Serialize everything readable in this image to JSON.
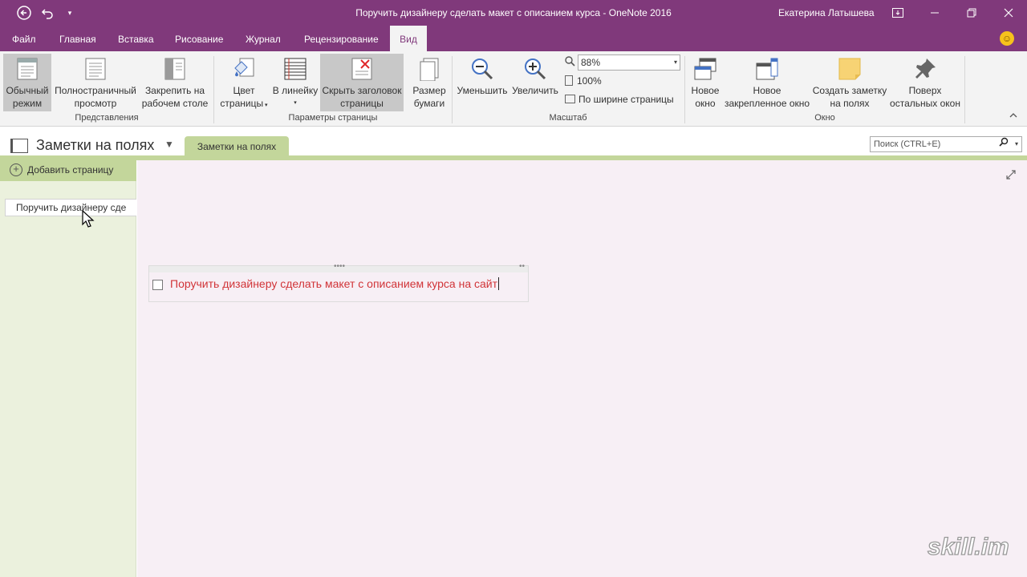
{
  "titlebar": {
    "title": "Поручить дизайнеру сделать макет с описанием курса  -  OneNote 2016",
    "user": "Екатерина Латышева",
    "back_icon": "back-arrow-icon",
    "undo_icon": "undo-icon",
    "customize_icon": "customize-dropdown-icon",
    "colors": {
      "bar": "#80397b"
    }
  },
  "menu": {
    "file": "Файл",
    "home": "Главная",
    "insert": "Вставка",
    "draw": "Рисование",
    "history": "Журнал",
    "review": "Рецензирование",
    "view": "Вид"
  },
  "ribbon": {
    "views": {
      "normal_1": "Обычный",
      "normal_2": "режим",
      "fullpage_1": "Полностраничный",
      "fullpage_2": "просмотр",
      "dock_1": "Закрепить на",
      "dock_2": "рабочем столе",
      "group": "Представления"
    },
    "page_setup": {
      "color_1": "Цвет",
      "color_2": "страницы",
      "ruled": "В линейку",
      "hide_title_1": "Скрыть заголовок",
      "hide_title_2": "страницы",
      "paper_1": "Размер",
      "paper_2": "бумаги",
      "group": "Параметры страницы"
    },
    "zoom": {
      "zoom_out": "Уменьшить",
      "zoom_in": "Увеличить",
      "value": "88%",
      "hundred": "100%",
      "page_width": "По ширине страницы",
      "group": "Масштаб"
    },
    "window": {
      "new_1": "Новое",
      "new_2": "окно",
      "docked_1": "Новое",
      "docked_2": "закрепленное окно",
      "quick_1": "Создать заметку",
      "quick_2": "на полях",
      "ontop_1": "Поверх",
      "ontop_2": "остальных окон",
      "group": "Окно"
    }
  },
  "notebook": {
    "name": "Заметки на полях",
    "section": "Заметки на полях",
    "search_placeholder": "Поиск (CTRL+E)",
    "colors": {
      "section": "#c3d69b",
      "pagelist": "#ebf1dd",
      "canvas": "#f7eff5"
    }
  },
  "pages": {
    "add_page": "Добавить страницу",
    "items": [
      "Поручить дизайнеру сде"
    ]
  },
  "note": {
    "text": "Поручить дизайнеру сделать макет с описанием курса на сайт",
    "color": "#d13438",
    "tag": "todo-checkbox"
  },
  "watermark": "skill.im"
}
